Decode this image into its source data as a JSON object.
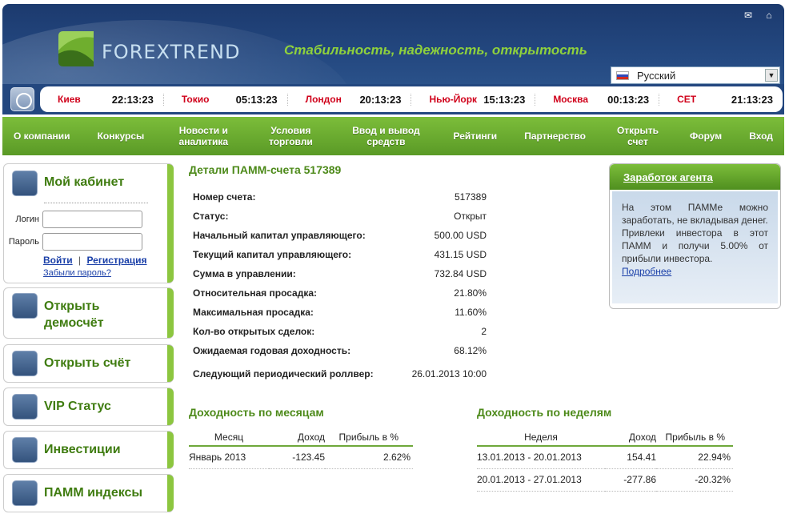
{
  "brand": {
    "logo_text": "FOREXTREND",
    "slogan": "Стабильность, надежность, открытость"
  },
  "language": {
    "selected": "Русский"
  },
  "world_clock": [
    {
      "city": "Киев",
      "time": "22:13:23"
    },
    {
      "city": "Токио",
      "time": "05:13:23"
    },
    {
      "city": "Лондон",
      "time": "20:13:23"
    },
    {
      "city": "Нью-Йорк",
      "time": "15:13:23"
    },
    {
      "city": "Москва",
      "time": "00:13:23"
    },
    {
      "city": "CET",
      "time": "21:13:23"
    }
  ],
  "nav": [
    "О компании",
    "Конкурсы",
    "Новости и аналитика",
    "Условия торговли",
    "Ввод и вывод средств",
    "Рейтинги",
    "Партнерство",
    "Открыть счет",
    "Форум",
    "Вход"
  ],
  "sidebar": {
    "cabinet": {
      "title": "Мой кабинет",
      "login_label": "Логин",
      "password_label": "Пароль",
      "login_link": "Войти",
      "separator": "|",
      "register_link": "Регистрация",
      "forgot_link": "Забыли пароль?"
    },
    "items": [
      "Открыть демосчёт",
      "Открыть счёт",
      "VIP Статус",
      "Инвестиции",
      "ПАММ индексы"
    ]
  },
  "details": {
    "title": "Детали ПАММ-счета 517389",
    "rows": [
      {
        "label": "Номер счета:",
        "value": "517389"
      },
      {
        "label": "Статус:",
        "value": "Открыт"
      },
      {
        "label": "Начальный капитал управляющего:",
        "value": "500.00 USD"
      },
      {
        "label": "Текущий капитал управляющего:",
        "value": "431.15 USD"
      },
      {
        "label": "Сумма в управлении:",
        "value": "732.84 USD"
      },
      {
        "label": "Относительная просадка:",
        "value": "21.80%"
      },
      {
        "label": "Максимальная просадка:",
        "value": "11.60%"
      },
      {
        "label": "Кол-во открытых сделок:",
        "value": "2"
      },
      {
        "label": "Ожидаемая годовая доходность:",
        "value": "68.12%"
      },
      {
        "label": "Следующий периодический роллвер:",
        "value": "26.01.2013 10:00"
      }
    ]
  },
  "monthly": {
    "title": "Доходность по месяцам",
    "headers": [
      "Месяц",
      "Доход",
      "Прибыль в %"
    ],
    "rows": [
      [
        "Январь 2013",
        "-123.45",
        "2.62%"
      ]
    ]
  },
  "weekly": {
    "title": "Доходность по неделям",
    "headers": [
      "Неделя",
      "Доход",
      "Прибыль в %"
    ],
    "rows": [
      [
        "13.01.2013 - 20.01.2013",
        "154.41",
        "22.94%"
      ],
      [
        "20.01.2013 - 27.01.2013",
        "-277.86",
        "-20.32%"
      ]
    ]
  },
  "agent": {
    "title": "Заработок агента",
    "text1": "На этом ПАММе можно заработать, не вкладывая денег.",
    "text2": "Привлеки инвестора в этот ПАММ и получи 5.00% от прибыли инвестора.",
    "more": "Подробнее"
  }
}
